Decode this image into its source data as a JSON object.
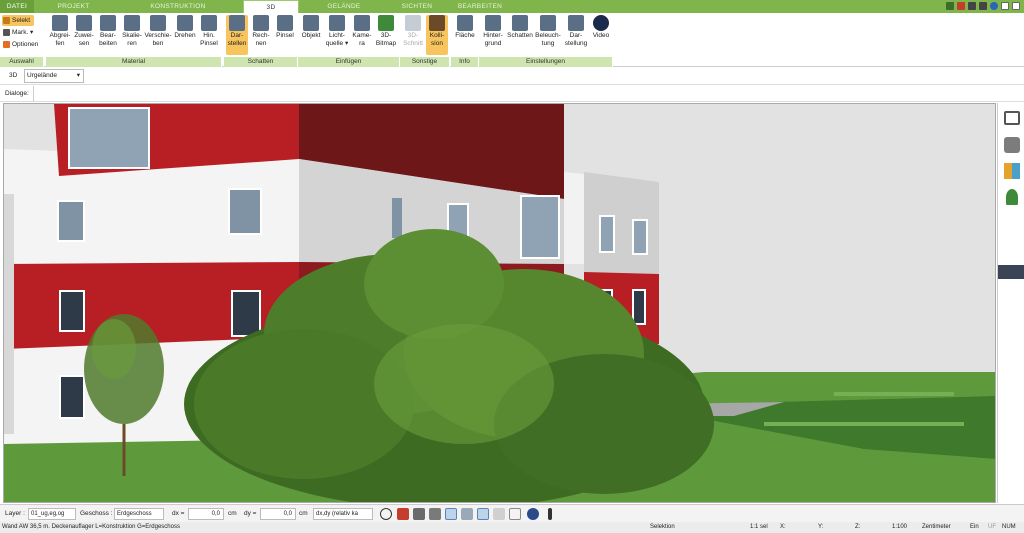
{
  "tabs": [
    "DATEI",
    "PROJEKT",
    "KONSTRUKTION",
    "3D",
    "GELÄNDE",
    "SICHTEN",
    "BEARBEITEN"
  ],
  "ribbon": {
    "auswahl": {
      "selekt": "Selekt",
      "mark": "Mark.",
      "optionen": "Optionen",
      "caption": "Auswahl"
    },
    "material": {
      "caption": "Material",
      "buttons": [
        {
          "l1": "Abgrei-",
          "l2": "fen"
        },
        {
          "l1": "Zuwei-",
          "l2": "sen"
        },
        {
          "l1": "Bear-",
          "l2": "beiten"
        },
        {
          "l1": "Skalie-",
          "l2": "ren"
        },
        {
          "l1": "Verschie-",
          "l2": "ben"
        },
        {
          "l1": "Drehen",
          "l2": ""
        },
        {
          "l1": "Hin.",
          "l2": "Pinsel"
        }
      ]
    },
    "schatten": {
      "caption": "Schatten",
      "buttons": [
        {
          "l1": "Dar-",
          "l2": "stellen"
        },
        {
          "l1": "Rech-",
          "l2": "nen"
        },
        {
          "l1": "Pinsel",
          "l2": ""
        }
      ]
    },
    "einfuegen": {
      "caption": "Einfügen",
      "buttons": [
        {
          "l1": "Objekt",
          "l2": ""
        },
        {
          "l1": "Licht-",
          "l2": "quelle"
        },
        {
          "l1": "Kame-",
          "l2": "ra"
        },
        {
          "l1": "3D-",
          "l2": "Bitmap"
        }
      ]
    },
    "sonstige": {
      "caption": "Sonstige",
      "buttons": [
        {
          "l1": "3D-",
          "l2": "Schnitt"
        },
        {
          "l1": "Kolli-",
          "l2": "sion"
        }
      ]
    },
    "info": {
      "caption": "Info",
      "buttons": [
        {
          "l1": "Fläche",
          "l2": ""
        }
      ]
    },
    "einstellungen": {
      "caption": "Einstellungen",
      "buttons": [
        {
          "l1": "Hinter-",
          "l2": "grund"
        },
        {
          "l1": "Schatten",
          "l2": ""
        },
        {
          "l1": "Beleuch-",
          "l2": "tung"
        },
        {
          "l1": "Dar-",
          "l2": "stellung"
        },
        {
          "l1": "Video",
          "l2": ""
        }
      ]
    }
  },
  "viewbar": {
    "mode": "3D",
    "select": "Urgelände"
  },
  "dialoge": {
    "label": "Dialoge:"
  },
  "statusbar": {
    "layer_label": "Layer :",
    "layer_value": "01_ug,eg,og",
    "geschoss_label": "Geschoss :",
    "geschoss_value": "Erdgeschoss",
    "dx_label": "dx =",
    "dx_value": "0,0",
    "dy_label": "dy =",
    "dy_value": "0,0",
    "unit": "cm",
    "mode_value": "dx,dy (relativ ka"
  },
  "infobar": {
    "text": "Wand AW 36,5 m. Deckenauflager L=Konstruktion G=Erdgeschoss",
    "selektion": "Selektion",
    "sel": "1:1 sel",
    "x": "X:",
    "y": "Y:",
    "z": "Z:",
    "scale": "1:100",
    "unit": "Zentimeter",
    "ein": "Ein",
    "uf": "UF",
    "num": "NUM"
  },
  "colors": {
    "ribbon_green": "#7fb54a",
    "group_caption": "#cfe5b0",
    "selected": "#f7c45e",
    "facade_red": "#b81f24",
    "grass": "#5e9a3c"
  }
}
